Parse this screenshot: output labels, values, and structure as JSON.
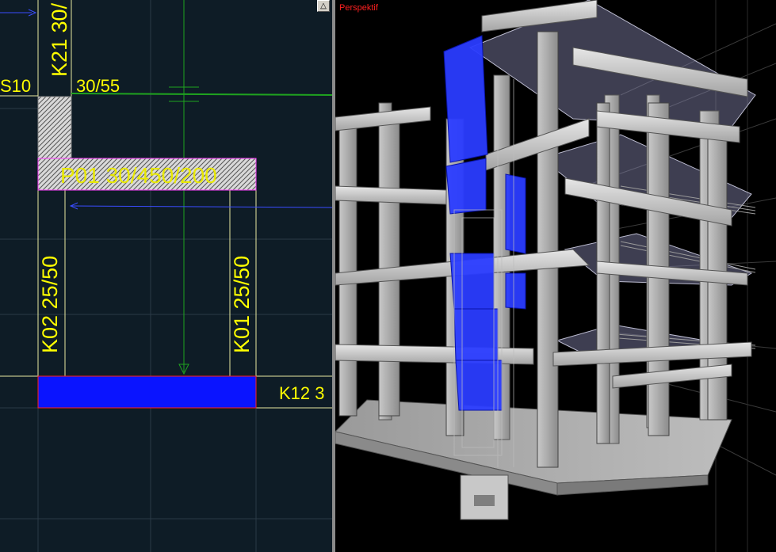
{
  "plan_view": {
    "labels": {
      "column_k21": "K21 30/",
      "beam_s10": "S10",
      "beam_dim": "30/55",
      "beam_p01": "P01 30/450/200",
      "column_k02": "K02 25/50",
      "column_k01": "K01 25/50",
      "beam_k12": "K12 3"
    },
    "maximize_glyph": "△"
  },
  "perspective_view": {
    "title": "Perspektif"
  },
  "colors": {
    "plan_background": "#0e1c26",
    "label_yellow": "#ffff00",
    "selection_blue": "#0a14ff",
    "axis_green": "#1fa31f",
    "perspective_title": "#ff2020"
  }
}
